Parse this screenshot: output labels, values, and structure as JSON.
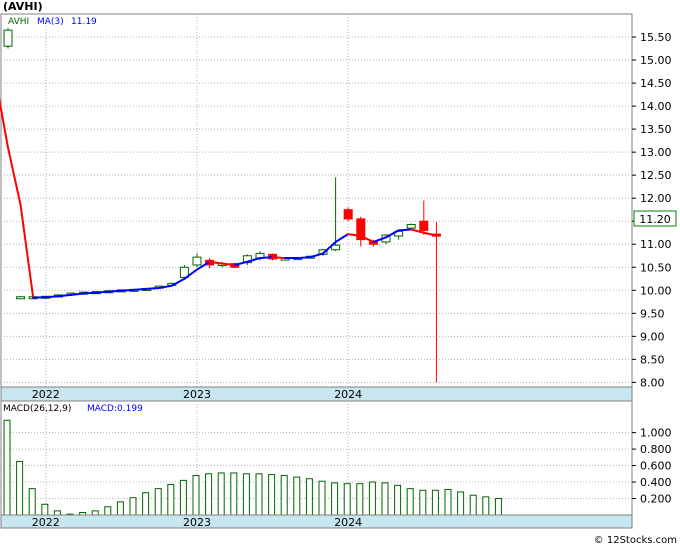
{
  "colors": {
    "background": "#ffffff",
    "axis_band": "#c8e6f0",
    "grid": "#b0b0b0",
    "candle_up": "#006400",
    "candle_down": "#ff0000",
    "ma_rising": "#0000ff",
    "ma_falling": "#ff0000",
    "macd_bar": "#006400",
    "price_box_border": "#008000"
  },
  "chart_data": [
    {
      "type": "candlestick",
      "title": "(AVHI)",
      "legend": {
        "symbol": "AVHI",
        "ma_label": "MA(3)",
        "ma_value": "11.19"
      },
      "last_price_label": "11.20",
      "yticks": [
        "15.50",
        "15.00",
        "14.50",
        "14.00",
        "13.50",
        "13.00",
        "12.50",
        "12.00",
        "11.50",
        "11.00",
        "10.50",
        "10.00",
        "9.50",
        "9.00",
        "8.50",
        "8.00"
      ],
      "ylim": [
        7.9,
        16.0
      ],
      "x_labels": [
        {
          "label": "2022",
          "index": 3
        },
        {
          "label": "2023",
          "index": 15
        },
        {
          "label": "2024",
          "index": 27
        }
      ],
      "grid": true,
      "candles": [
        {
          "o": 15.3,
          "h": 15.7,
          "l": 15.25,
          "c": 15.65
        },
        {
          "o": 9.84,
          "h": 9.87,
          "l": 9.83,
          "c": 9.86
        },
        {
          "o": 9.85,
          "h": 9.87,
          "l": 9.84,
          "c": 9.86
        },
        {
          "o": 9.86,
          "h": 9.88,
          "l": 9.85,
          "c": 9.87
        },
        {
          "o": 9.88,
          "h": 9.91,
          "l": 9.87,
          "c": 9.9
        },
        {
          "o": 9.92,
          "h": 9.95,
          "l": 9.91,
          "c": 9.94
        },
        {
          "o": 9.95,
          "h": 9.97,
          "l": 9.94,
          "c": 9.96
        },
        {
          "o": 9.96,
          "h": 9.98,
          "l": 9.95,
          "c": 9.97
        },
        {
          "o": 9.97,
          "h": 10.0,
          "l": 9.96,
          "c": 9.99
        },
        {
          "o": 10.0,
          "h": 10.02,
          "l": 9.99,
          "c": 10.01
        },
        {
          "o": 10.01,
          "h": 10.03,
          "l": 10.0,
          "c": 10.02
        },
        {
          "o": 10.02,
          "h": 10.05,
          "l": 10.01,
          "c": 10.04
        },
        {
          "o": 10.05,
          "h": 10.1,
          "l": 10.04,
          "c": 10.09
        },
        {
          "o": 10.12,
          "h": 10.17,
          "l": 10.1,
          "c": 10.15
        },
        {
          "o": 10.28,
          "h": 10.55,
          "l": 10.25,
          "c": 10.5
        },
        {
          "o": 10.55,
          "h": 10.8,
          "l": 10.5,
          "c": 10.72
        },
        {
          "o": 10.65,
          "h": 10.7,
          "l": 10.48,
          "c": 10.55
        },
        {
          "o": 10.55,
          "h": 10.62,
          "l": 10.5,
          "c": 10.58
        },
        {
          "o": 10.58,
          "h": 10.6,
          "l": 10.48,
          "c": 10.5
        },
        {
          "o": 10.6,
          "h": 10.78,
          "l": 10.55,
          "c": 10.75
        },
        {
          "o": 10.7,
          "h": 10.85,
          "l": 10.65,
          "c": 10.8
        },
        {
          "o": 10.78,
          "h": 10.8,
          "l": 10.65,
          "c": 10.68
        },
        {
          "o": 10.68,
          "h": 10.72,
          "l": 10.65,
          "c": 10.7
        },
        {
          "o": 10.7,
          "h": 10.72,
          "l": 10.68,
          "c": 10.71
        },
        {
          "o": 10.72,
          "h": 10.75,
          "l": 10.7,
          "c": 10.74
        },
        {
          "o": 10.78,
          "h": 10.9,
          "l": 10.75,
          "c": 10.88
        },
        {
          "o": 10.88,
          "h": 12.45,
          "l": 10.85,
          "c": 10.98
        },
        {
          "o": 11.75,
          "h": 11.8,
          "l": 11.5,
          "c": 11.55
        },
        {
          "o": 11.55,
          "h": 11.6,
          "l": 10.95,
          "c": 11.1
        },
        {
          "o": 11.05,
          "h": 11.1,
          "l": 10.95,
          "c": 11.0
        },
        {
          "o": 11.05,
          "h": 11.22,
          "l": 11.0,
          "c": 11.2
        },
        {
          "o": 11.18,
          "h": 11.3,
          "l": 11.1,
          "c": 11.28
        },
        {
          "o": 11.35,
          "h": 11.45,
          "l": 11.3,
          "c": 11.43
        },
        {
          "o": 11.5,
          "h": 11.95,
          "l": 11.2,
          "c": 11.3
        },
        {
          "o": 11.22,
          "h": 11.48,
          "l": 8.0,
          "c": 11.2
        }
      ],
      "ma": [
        14.6,
        13.1,
        11.85,
        9.84,
        9.85,
        9.87,
        9.9,
        9.93,
        9.95,
        9.97,
        9.99,
        10.01,
        10.03,
        10.05,
        10.1,
        10.25,
        10.45,
        10.62,
        10.58,
        10.55,
        10.62,
        10.7,
        10.72,
        10.7,
        10.7,
        10.72,
        10.8,
        11.05,
        11.22,
        11.18,
        11.05,
        11.15,
        11.3,
        11.32,
        11.25,
        11.19
      ],
      "ma_x_offset": -1
    },
    {
      "type": "bar",
      "title": "MACD(26,12,9)",
      "legend_value": "MACD:0.199",
      "yticks": [
        "1.000",
        "0.800",
        "0.600",
        "0.400",
        "0.200"
      ],
      "ylim": [
        0,
        1.25
      ],
      "x_labels": [
        {
          "label": "2022",
          "index": 3
        },
        {
          "label": "2023",
          "index": 15
        },
        {
          "label": "2024",
          "index": 27
        }
      ],
      "values": [
        1.15,
        0.65,
        0.32,
        0.13,
        0.05,
        0.01,
        0.03,
        0.05,
        0.1,
        0.16,
        0.21,
        0.27,
        0.32,
        0.37,
        0.42,
        0.48,
        0.5,
        0.51,
        0.51,
        0.5,
        0.5,
        0.49,
        0.48,
        0.46,
        0.44,
        0.41,
        0.39,
        0.38,
        0.38,
        0.4,
        0.39,
        0.36,
        0.32,
        0.3,
        0.3,
        0.31,
        0.28,
        0.24,
        0.22,
        0.2
      ]
    }
  ],
  "watermark": "© 12Stocks.com"
}
